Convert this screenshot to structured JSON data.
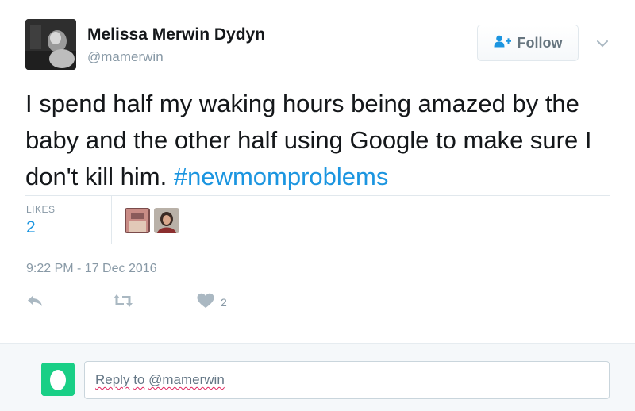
{
  "author": {
    "name": "Melissa Merwin Dydyn",
    "handle": "@mamerwin"
  },
  "follow_button": {
    "label": "Follow",
    "icon": "add-user-icon"
  },
  "menu": {
    "icon": "chevron-down-icon"
  },
  "tweet": {
    "text": "I spend half my waking hours being amazed by the baby and the other half using Google to make sure I don't kill him.",
    "hashtag": "#newmomproblems"
  },
  "stats": {
    "likes_label": "LIKES",
    "likes_count": "2"
  },
  "timestamp": "9:22 PM - 17 Dec 2016",
  "actions": {
    "reply_icon": "reply-icon",
    "retweet_icon": "retweet-icon",
    "like_icon": "heart-icon",
    "like_count": "2"
  },
  "reply_box": {
    "reply_word": "Reply",
    "to_word": "to",
    "mention": "@mamerwin"
  },
  "colors": {
    "accent": "#1b95e0",
    "muted": "#8899a6",
    "reply_avatar": "#19cf86"
  }
}
